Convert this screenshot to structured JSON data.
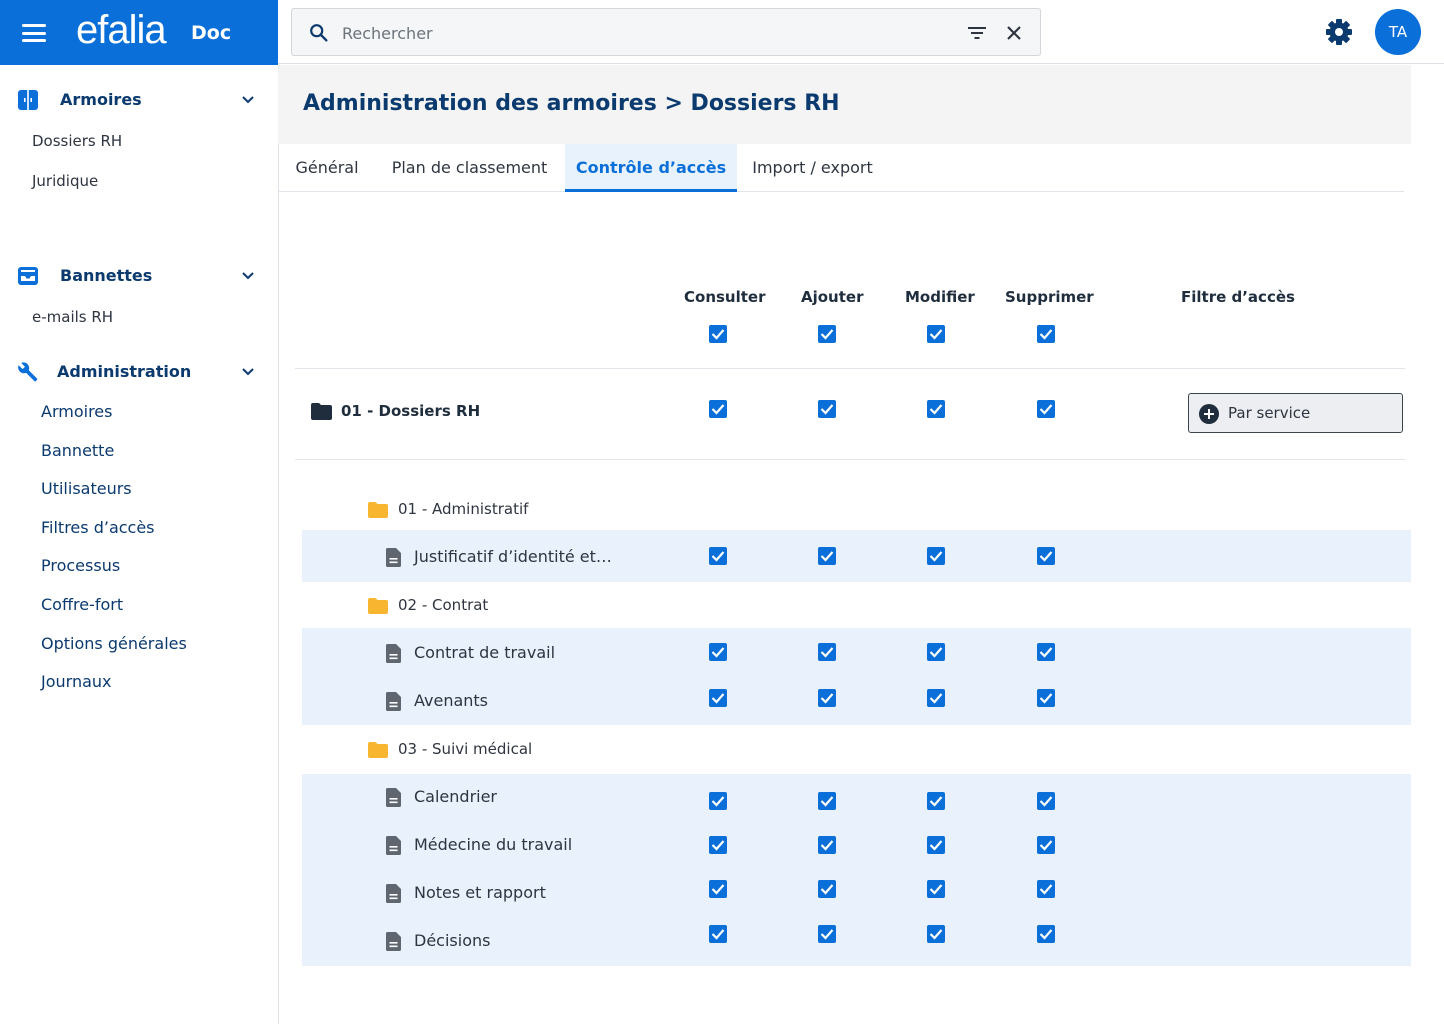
{
  "brand": {
    "name": "efalia",
    "product": "Doc"
  },
  "search": {
    "placeholder": "Rechercher"
  },
  "user": {
    "initials": "TA"
  },
  "colors": {
    "primary": "#0a6fd8",
    "navy": "#0b3a6f",
    "folder": "#f8b630",
    "band": "#e8f1fc"
  },
  "sidebar": {
    "armoires": {
      "title": "Armoires",
      "items": [
        "Dossiers RH",
        "Juridique"
      ]
    },
    "bannettes": {
      "title": "Bannettes",
      "items": [
        "e-mails RH"
      ]
    },
    "administration": {
      "title": "Administration",
      "items": [
        "Armoires",
        "Bannette",
        "Utilisateurs",
        "Filtres d’accès",
        "Processus",
        "Coffre-fort",
        "Options générales",
        "Journaux"
      ]
    }
  },
  "page": {
    "title": "Administration des armoires > Dossiers RH"
  },
  "tabs": [
    {
      "label": "Général",
      "active": false
    },
    {
      "label": "Plan de classement",
      "active": false
    },
    {
      "label": "Contrôle d’accès",
      "active": true
    },
    {
      "label": "Import / export",
      "active": false
    }
  ],
  "columns": [
    "Consulter",
    "Ajouter",
    "Modifier",
    "Supprimer",
    "Filtre d’accès"
  ],
  "root": {
    "label": "01 - Dossiers RH",
    "filter_button": "Par service"
  },
  "groups": [
    {
      "label": "01 - Administratif",
      "documents": [
        "Justificatif d’identité et…"
      ]
    },
    {
      "label": "02 - Contrat",
      "documents": [
        "Contrat de travail",
        "Avenants"
      ]
    },
    {
      "label": "03 - Suivi médical",
      "documents": [
        "Calendrier",
        "Médecine du travail",
        "Notes et rapport",
        "Décisions"
      ]
    }
  ],
  "permissions_all_checked": true
}
